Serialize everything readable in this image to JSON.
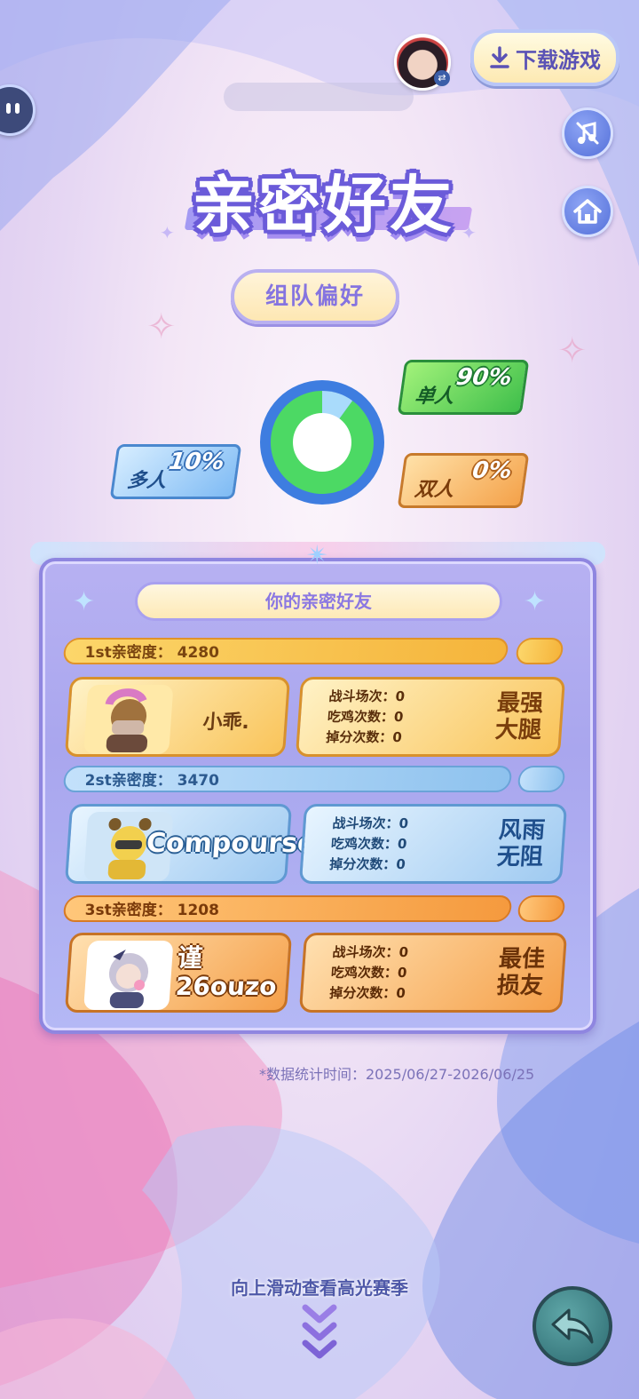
{
  "header": {
    "search_placeholder": "",
    "download_label": "下载游戏"
  },
  "title": "亲密好友",
  "section_label": "组队偏好",
  "team_preference": {
    "solo": {
      "label": "单人",
      "percent": "90%",
      "value": 90
    },
    "squad": {
      "label": "多人",
      "percent": "10%",
      "value": 10
    },
    "duo": {
      "label": "双人",
      "percent": "0%",
      "value": 0
    }
  },
  "friends_panel": {
    "header": "你的亲密好友",
    "friends": [
      {
        "rank_label": "1st亲密度：",
        "intimacy": "4280",
        "name": "小乖.",
        "stats": {
          "battles": "战斗场次：0",
          "wins": "吃鸡次数：0",
          "lost_points": "掉分次数：0"
        },
        "badge_line1": "最强",
        "badge_line2": "大腿"
      },
      {
        "rank_label": "2st亲密度：",
        "intimacy": "3470",
        "name": "Compourse.",
        "stats": {
          "battles": "战斗场次：0",
          "wins": "吃鸡次数：0",
          "lost_points": "掉分次数：0"
        },
        "badge_line1": "风雨",
        "badge_line2": "无阻"
      },
      {
        "rank_label": "3st亲密度：",
        "intimacy": "1208",
        "name_line1": "谨",
        "name_line2": "26ouzo",
        "stats": {
          "battles": "战斗场次：0",
          "wins": "吃鸡次数：0",
          "lost_points": "掉分次数：0"
        },
        "badge_line1": "最佳",
        "badge_line2": "损友"
      }
    ]
  },
  "footer": {
    "date_range": "*数据统计时间：2025/06/27-2026/06/25",
    "swipe_hint": "向上滑动查看高光赛季"
  },
  "colors": {
    "solo": "#4cd964",
    "squad": "#a9dbfb",
    "duo": "#f4a24a",
    "ring": "#3e7de0"
  },
  "icons": [
    "chat-bubble-icon",
    "swap-icon",
    "download-icon",
    "music-off-icon",
    "home-icon",
    "back-arrow-icon",
    "chevron-down-icon"
  ]
}
